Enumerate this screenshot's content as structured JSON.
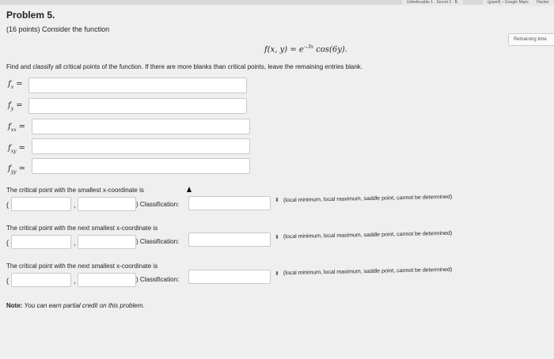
{
  "browser_tabs": [
    "Unbelievable 1 · Secret 2 · B.",
    "(gspell) – Google Maps",
    "Hacker"
  ],
  "problem": {
    "title": "Problem 5.",
    "subtitle": "(16 points) Consider the function",
    "remaining_time": "Remaining time",
    "function_lhs": "f(x, y) = e",
    "function_exp": "−3x",
    "function_rhs": " cos(6y).",
    "instructions": "Find and classify all critical points of the function. If there are more blanks than critical points, leave the remaining entries blank."
  },
  "derivatives": [
    {
      "sym": "f",
      "sub": "x",
      "value": ""
    },
    {
      "sym": "f",
      "sub": "y",
      "value": ""
    },
    {
      "sym": "f",
      "sub": "xx",
      "value": ""
    },
    {
      "sym": "f",
      "sub": "xy",
      "value": ""
    },
    {
      "sym": "f",
      "sub": "yy",
      "value": ""
    }
  ],
  "equals": "=",
  "critical_points": [
    {
      "heading": "The critical point with the smallest x-coordinate is",
      "open": "(",
      "comma": ",",
      "close_classification": ") Classification:",
      "x": "",
      "y": "",
      "classification": ""
    },
    {
      "heading": "The critical point with the next smallest x-coordinate is",
      "open": "(",
      "comma": ",",
      "close_classification": ") Classification:",
      "x": "",
      "y": "",
      "classification": ""
    },
    {
      "heading": "The critical point with the next smallest x-coordinate is",
      "open": "(",
      "comma": ",",
      "close_classification": ") Classification:",
      "x": "",
      "y": "",
      "classification": ""
    }
  ],
  "classification_options": "(local minimum, local maximum, saddle point, cannot be determined)",
  "select_arrow_glyph": "⬍",
  "note_label": "Note:",
  "note_text": " You can earn partial credit on this problem."
}
